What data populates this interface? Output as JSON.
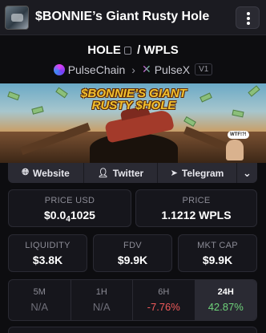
{
  "header": {
    "title": "$BONNIE’s Giant Rusty Hole",
    "menu_icon": "vertical-dots-icon"
  },
  "pair": {
    "base": "HOLE",
    "separator": "/",
    "quote": "WPLS",
    "copy_icon": "copy-icon"
  },
  "chain": {
    "network": "PulseChain",
    "dex": "PulseX",
    "version": "V1"
  },
  "banner": {
    "title": "$BONNIE’S GIANT RUSTY $HOLE",
    "bubble_text": "WTF!?!"
  },
  "socials": [
    {
      "label": "Website",
      "icon": "globe-icon"
    },
    {
      "label": "Twitter",
      "icon": "user-icon"
    },
    {
      "label": "Telegram",
      "icon": "paper-plane-icon"
    }
  ],
  "prices": {
    "usd_label": "PRICE USD",
    "usd_value_prefix": "$0.0",
    "usd_value_sub": "4",
    "usd_value_rest": "1025",
    "native_label": "PRICE",
    "native_value": "1.1212 WPLS"
  },
  "metrics": {
    "liquidity_label": "LIQUIDITY",
    "liquidity_value": "$3.8K",
    "fdv_label": "FDV",
    "fdv_value": "$9.9K",
    "mcap_label": "MKT CAP",
    "mcap_value": "$9.9K"
  },
  "changes": [
    {
      "period": "5M",
      "value": "N/A"
    },
    {
      "period": "1H",
      "value": "N/A"
    },
    {
      "period": "6H",
      "value": "-7.76%"
    },
    {
      "period": "24H",
      "value": "42.87%"
    }
  ],
  "colors": {
    "negative": "#ef5a5a",
    "positive": "#6ed17a",
    "background": "#0d0d10"
  }
}
